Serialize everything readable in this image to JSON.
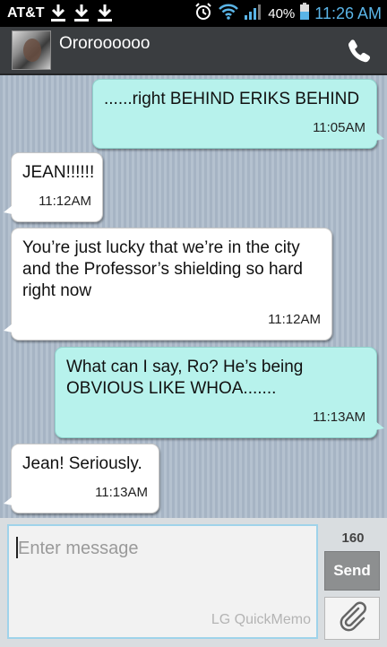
{
  "status_bar": {
    "carrier": "AT&T",
    "battery": "40%",
    "time": "11:26 AM",
    "icons": [
      "download-icon",
      "download-icon",
      "download-icon",
      "alarm-icon",
      "wifi-icon",
      "signal-icon",
      "battery-icon"
    ]
  },
  "header": {
    "contact_name": "Ororoooooo"
  },
  "messages": [
    {
      "direction": "outgoing",
      "text": "......right BEHIND ERIKS BEHIND",
      "time": "11:05AM"
    },
    {
      "direction": "incoming",
      "text": "JEAN!!!!!!",
      "time": "11:12AM"
    },
    {
      "direction": "incoming",
      "text": "You’re just lucky that we’re in the city and the Professor’s shielding so hard right now",
      "time": "11:12AM"
    },
    {
      "direction": "outgoing",
      "text": "What can I say, Ro? He’s being OBVIOUS LIKE WHOA.......",
      "time": "11:13AM"
    },
    {
      "direction": "incoming",
      "text": "Jean! Seriously.",
      "time": "11:13AM"
    }
  ],
  "compose": {
    "placeholder": "Enter message",
    "watermark": "LG QuickMemo",
    "char_count": "160",
    "send_label": "Send"
  },
  "colors": {
    "outgoing_bubble": "#b7f2ec",
    "incoming_bubble": "#ffffff",
    "clock": "#5ab4e6",
    "header_bg": "#3a3d40"
  }
}
